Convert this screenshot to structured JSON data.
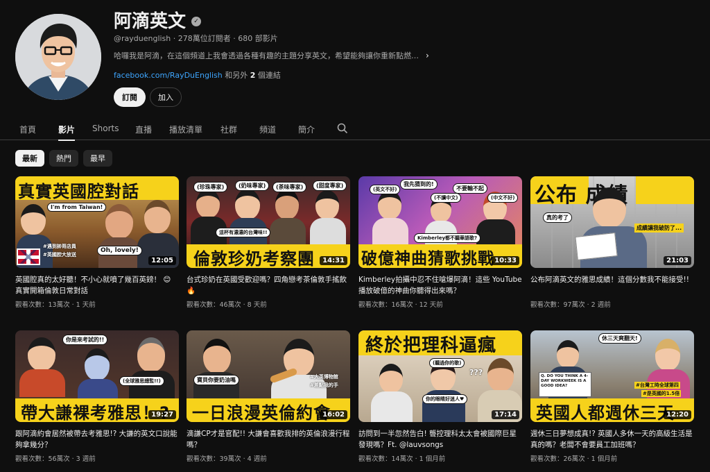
{
  "channel": {
    "name": "阿滴英文",
    "verified_icon": "verified-check-icon",
    "meta": "@rayduenglish · 278萬位訂閱者 · 680 部影片",
    "description": "哈囉我是阿滴，在這個頻道上我會透過各種有趣的主題分享英文，希望能夠讓你重新點燃對...",
    "link_text": "facebook.com/RayDuEnglish",
    "link_suffix_pre": " 和另外 ",
    "link_count": "2",
    "link_suffix_post": " 個連結",
    "subscribe_label": "訂閱",
    "join_label": "加入"
  },
  "tabs": [
    "首頁",
    "影片",
    "Shorts",
    "直播",
    "播放清單",
    "社群",
    "頻道",
    "簡介"
  ],
  "active_tab": "影片",
  "filters": [
    "最新",
    "熱門",
    "最早"
  ],
  "active_filter": "最新",
  "videos": [
    {
      "thumb_title": "真實英國腔對話",
      "duration": "12:05",
      "title": "英國腔真的太好聽！不小心就噴了幾百英鎊！ 😊 真實開箱倫敦日常對話",
      "views": "觀看次數：13萬次",
      "age": "1 天前"
    },
    {
      "thumb_title": "倫敦珍奶考察團",
      "duration": "14:31",
      "title": "台式珍奶在英國受歡迎嗎？四角戀考茶倫敦手搖飲🔥",
      "views": "觀看次數：46萬次",
      "age": "8 天前"
    },
    {
      "thumb_title": "破億神曲猜歌挑戰",
      "duration": "10:33",
      "title": "Kimberley拍攝中忍不住嗆爆阿滴！這些 YouTube播放破億的神曲你聽得出來嗎？",
      "views": "觀看次數：16萬次",
      "age": "12 天前"
    },
    {
      "thumb_title": "公布 成績",
      "duration": "21:03",
      "title": "公布阿滴英文的雅思成績！這個分數我不能接受!!",
      "views": "觀看次數：97萬次",
      "age": "2 週前"
    },
    {
      "thumb_title": "帶大謙裸考雅思！?",
      "duration": "19:27",
      "title": "跟阿滴約會居然被帶去考雅思!? 大謙的英文口說能夠拿幾分？",
      "views": "觀看次數：56萬次",
      "age": "3 週前"
    },
    {
      "thumb_title": "一日浪漫英倫約會",
      "duration": "16:02",
      "title": "滴謙CP才是官配!! 大謙會喜歡我排的英倫浪漫行程嗎？",
      "views": "觀看次數：39萬次",
      "age": "4 週前"
    },
    {
      "thumb_title": "終於把理科逼瘋",
      "duration": "17:14",
      "title": "訪問到一半忽然告白! 聾控理科太太會被國際巨星發現嗎？Ft. @lauvsongs",
      "views": "觀看次數：14萬次",
      "age": "1 個月前"
    },
    {
      "thumb_title": "英國人都週休三天",
      "duration": "12:20",
      "title": "週休三日夢想成真!? 英國人多休一天的高級生活是真的嗎？老闆不會要員工加班嗎？",
      "views": "觀看次數：26萬次",
      "age": "1 個月前"
    }
  ],
  "thumb_text": {
    "v1_bubble1": "I'm from Taiwan!",
    "v1_bubble2": "Oh, lovely!",
    "v1_tag1": "#遇到帥哥店員",
    "v1_tag2": "#英國腔大放送",
    "v2_b1": "(珍珠專家)",
    "v2_b2": "(奶味專家)",
    "v2_b3": "(茶味專家)",
    "v2_b4": "(甜度專家)",
    "v2_b5": "這杯有濃濃的台灣味!!",
    "v3_b1": "我先猜到的!",
    "v3_b2": "不要輸不起",
    "v3_b3": "(英文不好)",
    "v3_b4": "(不讀中文)",
    "v3_b5": "(中文不好)",
    "v3_b6": "Kimberley都不聽華語歌?",
    "v4_b1": "真的考了",
    "v4_b2": "成績讓我破防了...",
    "v5_b1": "你是來考試的!!",
    "v5_b2": "(全球雅思總監!!)",
    "v6_b1": "寶貝你要奶油嗎",
    "v6_b2": "#大英博物館",
    "v6_b3": "#差點我的手",
    "v7_b1": "你的眼睛好迷人♥",
    "v7_b2": "(聽過你的歌)",
    "v7_b3": "???",
    "v8_b1": "休三天爽翻天!",
    "v8_b2": "Q. DO YOU THINK A 4-DAY WORKWEEK IS A GOOD IDEA?",
    "v8_b3": "#台灣工時全球第四",
    "v8_b4": "#是英國的1.5倍"
  },
  "colors": {
    "bg": "#0f0f0f",
    "text": "#f1f1f1",
    "muted": "#aaaaaa",
    "link": "#3ea6ff",
    "thumb_yellow": "#f6d21b"
  }
}
